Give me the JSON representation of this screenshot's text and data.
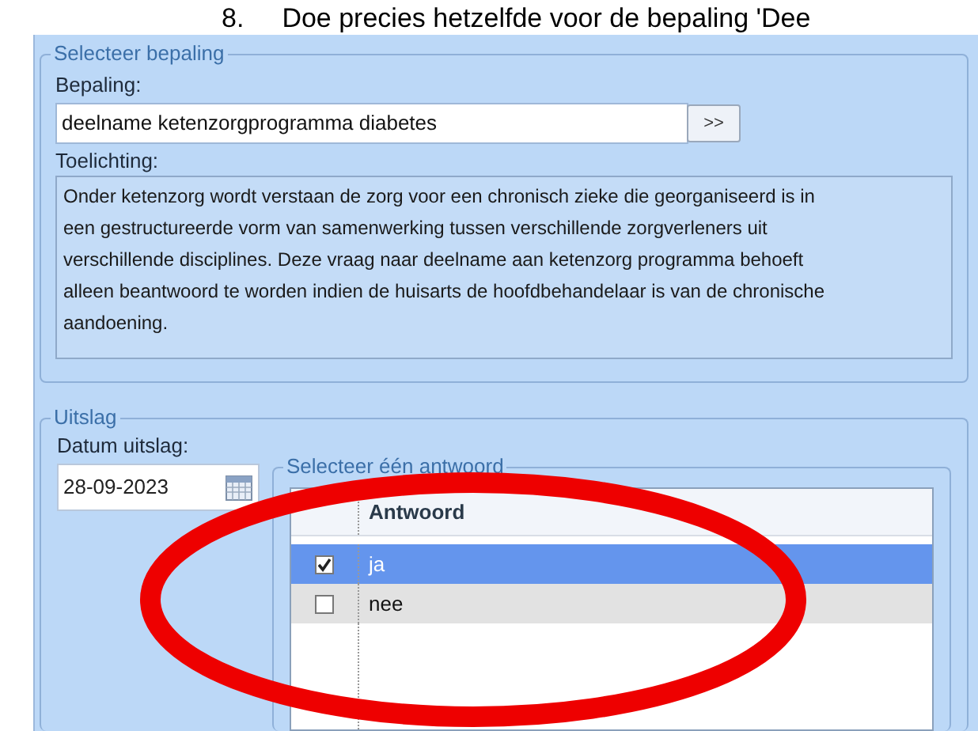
{
  "instruction": {
    "number": "8.",
    "text": "Doe precies hetzelfde voor de bepaling 'Dee"
  },
  "select_group": {
    "title": "Selecteer bepaling",
    "field_label": "Bepaling:",
    "field_value": "deelname ketenzorgprogramma diabetes",
    "browse_button": ">>",
    "note_label": "Toelichting:",
    "note": "Onder ketenzorg wordt verstaan de zorg voor een chronisch zieke die georganiseerd is in een gestructureerde vorm van samenwerking tussen verschillende zorgverleners uit verschillende disciplines. Deze vraag naar deelname aan ketenzorg programma behoeft alleen beantwoord te worden indien de huisarts de hoofdbehandelaar is van de chronische aandoening."
  },
  "result_group": {
    "title": "Uitslag",
    "date_label": "Datum uitslag:",
    "date_value": "28-09-2023",
    "answer_group": {
      "title": "Selecteer één antwoord",
      "column": "Antwoord",
      "rows": [
        {
          "label": "ja",
          "checked": true,
          "selected": true
        },
        {
          "label": "nee",
          "checked": false,
          "selected": false
        }
      ]
    }
  },
  "annotation": {
    "kind": "ellipse"
  }
}
